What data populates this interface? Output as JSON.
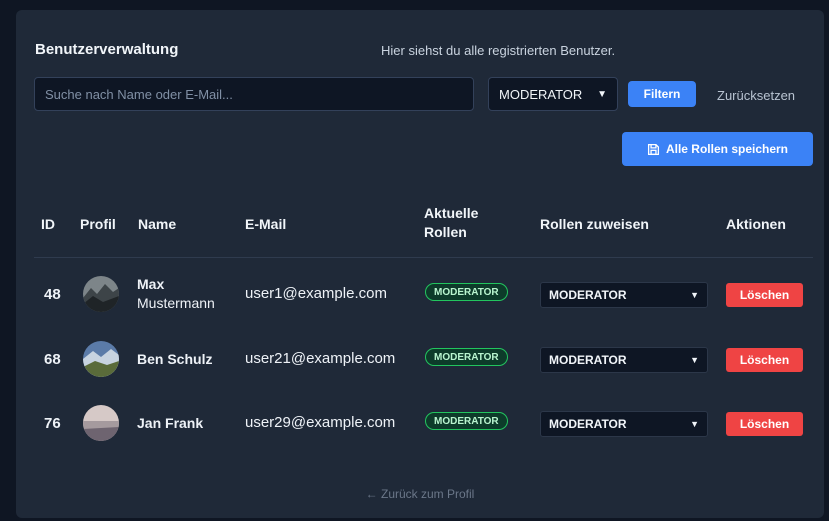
{
  "header": {
    "title": "Benutzerverwaltung",
    "subtitle": "Hier siehst du alle registrierten Benutzer."
  },
  "filters": {
    "search_placeholder": "Suche nach Name oder E-Mail...",
    "search_value": "",
    "role_selected": "MODERATOR",
    "filter_label": "Filtern",
    "reset_label": "Zurücksetzen"
  },
  "actions": {
    "save_all_label": "Alle Rollen speichern"
  },
  "table": {
    "columns": {
      "id": "ID",
      "profile": "Profil",
      "name": "Name",
      "email": "E-Mail",
      "current_roles_1": "Aktuelle",
      "current_roles_2": "Rollen",
      "assign_roles": "Rollen zuweisen",
      "actions": "Aktionen"
    },
    "rows": [
      {
        "id": "48",
        "name_1": "Max",
        "name_2": "Mustermann",
        "email": "user1@example.com",
        "badge": "MODERATOR",
        "role": "MODERATOR",
        "delete": "Löschen"
      },
      {
        "id": "68",
        "name_1": "Ben Schulz",
        "name_2": "",
        "email": "user21@example.com",
        "badge": "MODERATOR",
        "role": "MODERATOR",
        "delete": "Löschen"
      },
      {
        "id": "76",
        "name_1": "Jan Frank",
        "name_2": "",
        "email": "user29@example.com",
        "badge": "MODERATOR",
        "role": "MODERATOR",
        "delete": "Löschen"
      }
    ]
  },
  "footer": {
    "back_label": "← Zurück zum Profil"
  },
  "colors": {
    "background": "#0f1623",
    "panel": "#1f2938",
    "primary": "#3b82f6",
    "danger": "#ef4444",
    "badge_border": "#22c55e"
  },
  "icons": {
    "save": "floppy-disk-icon",
    "dropdown": "chevron-down-icon"
  }
}
